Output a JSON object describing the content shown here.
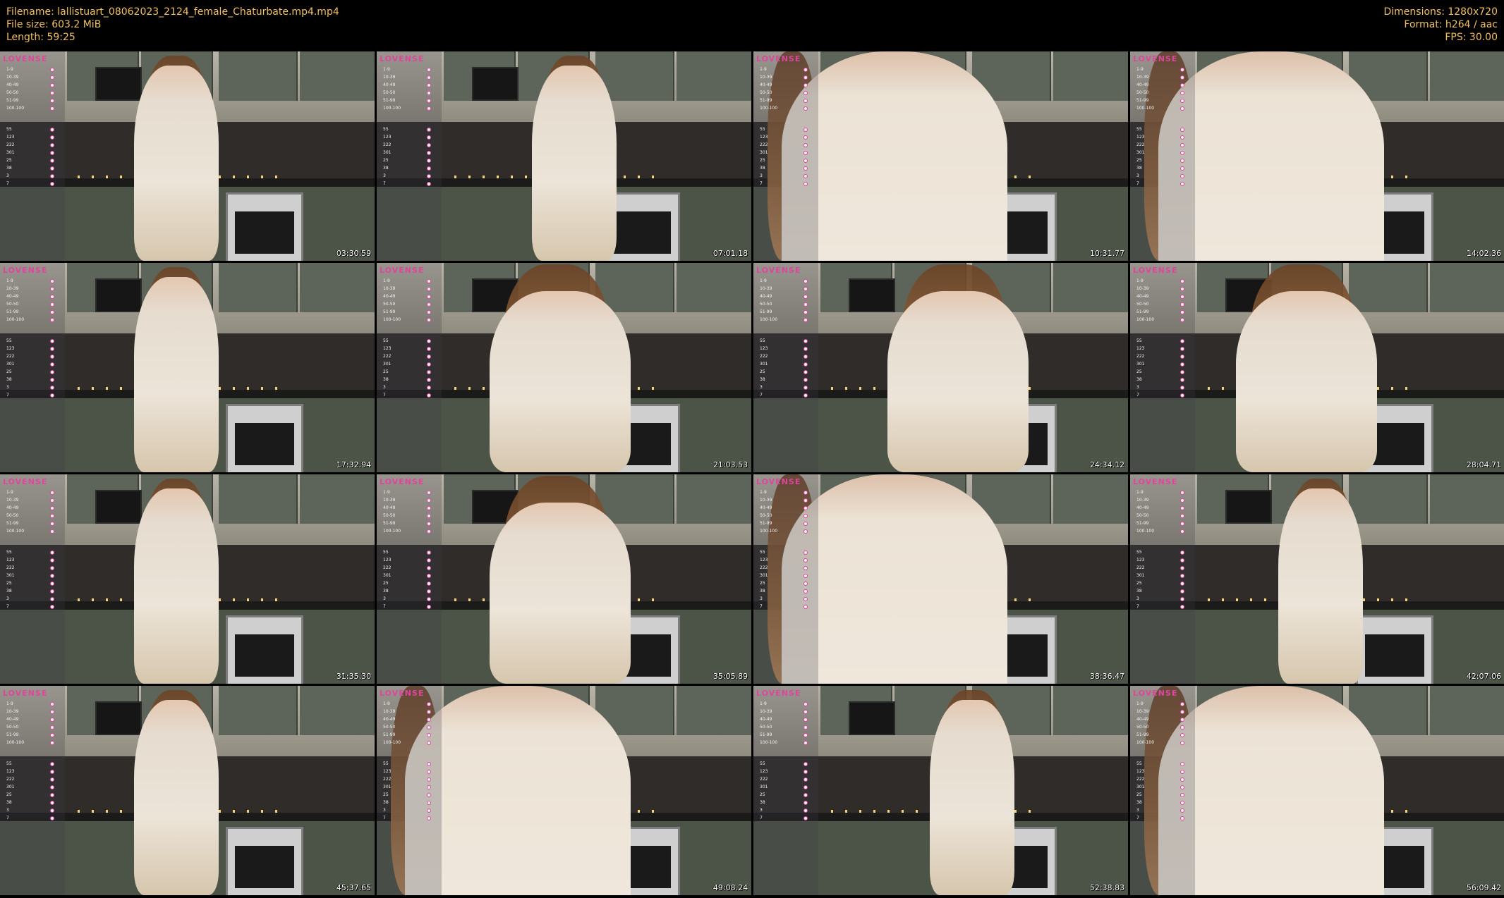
{
  "header": {
    "left": [
      "Filename: lallistuart_08062023_2124_female_Chaturbate.mp4.mp4",
      "File size: 603.2 MiB",
      "Length: 59:25"
    ],
    "right": [
      "Dimensions: 1280x720",
      "Format: h264 / aac",
      "FPS: 30.00"
    ]
  },
  "overlay": {
    "logo": "LOVENSE",
    "rows": [
      "1-9",
      "10-39",
      "40-49",
      "50-50",
      "51-99",
      "100-100",
      "",
      "55",
      "123",
      "222",
      "301",
      "25",
      "38",
      "3",
      "7"
    ]
  },
  "thumbnails": [
    {
      "timestamp": "03:30.59",
      "view": "full"
    },
    {
      "timestamp": "07:01.18",
      "view": "full"
    },
    {
      "timestamp": "10:31.77",
      "view": "close"
    },
    {
      "timestamp": "14:02.36",
      "view": "close"
    },
    {
      "timestamp": "17:32.94",
      "view": "full"
    },
    {
      "timestamp": "21:03.53",
      "view": "mid"
    },
    {
      "timestamp": "24:34.12",
      "view": "mid"
    },
    {
      "timestamp": "28:04.71",
      "view": "mid"
    },
    {
      "timestamp": "31:35.30",
      "view": "full"
    },
    {
      "timestamp": "35:05.89",
      "view": "mid"
    },
    {
      "timestamp": "38:36.47",
      "view": "close"
    },
    {
      "timestamp": "42:07.06",
      "view": "full"
    },
    {
      "timestamp": "45:37.65",
      "view": "full"
    },
    {
      "timestamp": "49:08.24",
      "view": "close"
    },
    {
      "timestamp": "52:38.83",
      "view": "full"
    },
    {
      "timestamp": "56:09.42",
      "view": "close"
    }
  ]
}
